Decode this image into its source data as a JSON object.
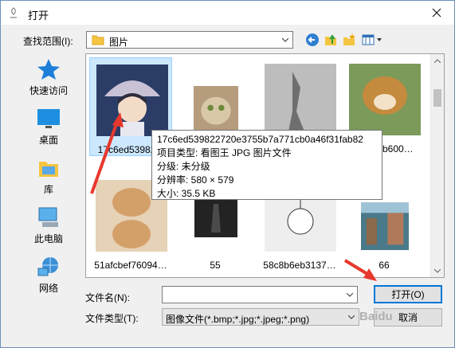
{
  "window": {
    "title": "打开"
  },
  "lookin": {
    "label": "查找范围(I):",
    "value": "图片"
  },
  "places": [
    {
      "label": "快速访问",
      "icon": "star-icon"
    },
    {
      "label": "桌面",
      "icon": "desktop-icon"
    },
    {
      "label": "库",
      "icon": "library-icon"
    },
    {
      "label": "此电脑",
      "icon": "computer-icon"
    },
    {
      "label": "网络",
      "icon": "network-icon"
    }
  ],
  "files": [
    {
      "caption": "17c6ed53982…",
      "selected": true,
      "color": "#2b3d66"
    },
    {
      "caption": "",
      "color": "#b59c7d"
    },
    {
      "caption": "",
      "color": "#9a9a9a"
    },
    {
      "caption": "…9b600…",
      "color": "#c48a3d"
    },
    {
      "caption": "51afcbef76094…",
      "color": "#d4a06a"
    },
    {
      "caption": "55",
      "color": "#232323"
    },
    {
      "caption": "58c8b6eb3137…",
      "color": "#e8e8e8"
    },
    {
      "caption": "66",
      "color": "#4a7a8a"
    }
  ],
  "tooltip": {
    "name": "17c6ed539822720e3755b7a771cb0a46f31fab82",
    "type": "项目类型: 看图王 JPG 图片文件",
    "rating": "分级: 未分级",
    "dimensions": "分辨率: 580 × 579",
    "size": "大小: 35.5 KB"
  },
  "filename": {
    "label": "文件名(N):",
    "value": ""
  },
  "filetype": {
    "label": "文件类型(T):",
    "value": "图像文件(*.bmp;*.jpg;*.jpeg;*.png)"
  },
  "buttons": {
    "open": "打开(O)",
    "cancel": "取消"
  },
  "watermark": "Baidu"
}
